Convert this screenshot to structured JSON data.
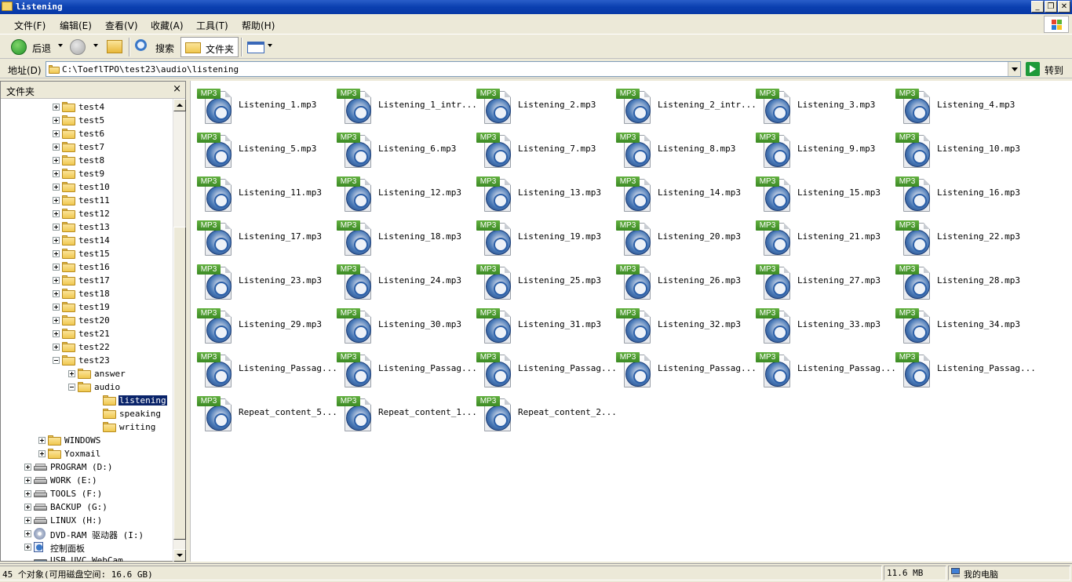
{
  "window": {
    "title": "listening",
    "controls": [
      "minimize",
      "restore",
      "close"
    ]
  },
  "menu": {
    "items": [
      "文件(F)",
      "编辑(E)",
      "查看(V)",
      "收藏(A)",
      "工具(T)",
      "帮助(H)"
    ]
  },
  "toolbar": {
    "back_label": "后退",
    "search_label": "搜索",
    "folders_label": "文件夹"
  },
  "address": {
    "label": "地址(D)",
    "value": "C:\\ToeflTPO\\test23\\audio\\listening",
    "go_label": "转到"
  },
  "folder_pane": {
    "title": "文件夹",
    "close_glyph": "×",
    "tree": [
      {
        "label": "test4",
        "level": 2,
        "expander": "plus",
        "icon": "folder"
      },
      {
        "label": "test5",
        "level": 2,
        "expander": "plus",
        "icon": "folder"
      },
      {
        "label": "test6",
        "level": 2,
        "expander": "plus",
        "icon": "folder"
      },
      {
        "label": "test7",
        "level": 2,
        "expander": "plus",
        "icon": "folder"
      },
      {
        "label": "test8",
        "level": 2,
        "expander": "plus",
        "icon": "folder"
      },
      {
        "label": "test9",
        "level": 2,
        "expander": "plus",
        "icon": "folder"
      },
      {
        "label": "test10",
        "level": 2,
        "expander": "plus",
        "icon": "folder"
      },
      {
        "label": "test11",
        "level": 2,
        "expander": "plus",
        "icon": "folder"
      },
      {
        "label": "test12",
        "level": 2,
        "expander": "plus",
        "icon": "folder"
      },
      {
        "label": "test13",
        "level": 2,
        "expander": "plus",
        "icon": "folder"
      },
      {
        "label": "test14",
        "level": 2,
        "expander": "plus",
        "icon": "folder"
      },
      {
        "label": "test15",
        "level": 2,
        "expander": "plus",
        "icon": "folder"
      },
      {
        "label": "test16",
        "level": 2,
        "expander": "plus",
        "icon": "folder"
      },
      {
        "label": "test17",
        "level": 2,
        "expander": "plus",
        "icon": "folder"
      },
      {
        "label": "test18",
        "level": 2,
        "expander": "plus",
        "icon": "folder"
      },
      {
        "label": "test19",
        "level": 2,
        "expander": "plus",
        "icon": "folder"
      },
      {
        "label": "test20",
        "level": 2,
        "expander": "plus",
        "icon": "folder"
      },
      {
        "label": "test21",
        "level": 2,
        "expander": "plus",
        "icon": "folder"
      },
      {
        "label": "test22",
        "level": 2,
        "expander": "plus",
        "icon": "folder"
      },
      {
        "label": "test23",
        "level": 2,
        "expander": "minus",
        "icon": "folder"
      },
      {
        "label": "answer",
        "level": 3,
        "expander": "plus",
        "icon": "folder"
      },
      {
        "label": "audio",
        "level": 3,
        "expander": "minus",
        "icon": "folder"
      },
      {
        "label": "listening",
        "level": 4,
        "expander": "none",
        "icon": "folder",
        "selected": true
      },
      {
        "label": "speaking",
        "level": 4,
        "expander": "none",
        "icon": "folder"
      },
      {
        "label": "writing",
        "level": 4,
        "expander": "none",
        "icon": "folder"
      },
      {
        "label": "WINDOWS",
        "level": 1,
        "expander": "plus",
        "icon": "folder"
      },
      {
        "label": "Yoxmail",
        "level": 1,
        "expander": "plus",
        "icon": "folder"
      },
      {
        "label": "PROGRAM (D:)",
        "level": 0,
        "expander": "plus",
        "icon": "drive"
      },
      {
        "label": "WORK (E:)",
        "level": 0,
        "expander": "plus",
        "icon": "drive"
      },
      {
        "label": "TOOLS (F:)",
        "level": 0,
        "expander": "plus",
        "icon": "drive"
      },
      {
        "label": "BACKUP (G:)",
        "level": 0,
        "expander": "plus",
        "icon": "drive"
      },
      {
        "label": "LINUX (H:)",
        "level": 0,
        "expander": "plus",
        "icon": "drive"
      },
      {
        "label": "DVD-RAM 驱动器 (I:)",
        "level": 0,
        "expander": "plus",
        "icon": "dvd"
      },
      {
        "label": "控制面板",
        "level": 0,
        "expander": "plus",
        "icon": "control-panel"
      },
      {
        "label": "USB UVC WebCam",
        "level": 0,
        "expander": "none",
        "icon": "webcam"
      }
    ]
  },
  "files": {
    "badge": "MP3",
    "items": [
      "Listening_1.mp3",
      "Listening_1_intr...",
      "Listening_2.mp3",
      "Listening_2_intr...",
      "Listening_3.mp3",
      "Listening_4.mp3",
      "Listening_5.mp3",
      "Listening_6.mp3",
      "Listening_7.mp3",
      "Listening_8.mp3",
      "Listening_9.mp3",
      "Listening_10.mp3",
      "Listening_11.mp3",
      "Listening_12.mp3",
      "Listening_13.mp3",
      "Listening_14.mp3",
      "Listening_15.mp3",
      "Listening_16.mp3",
      "Listening_17.mp3",
      "Listening_18.mp3",
      "Listening_19.mp3",
      "Listening_20.mp3",
      "Listening_21.mp3",
      "Listening_22.mp3",
      "Listening_23.mp3",
      "Listening_24.mp3",
      "Listening_25.mp3",
      "Listening_26.mp3",
      "Listening_27.mp3",
      "Listening_28.mp3",
      "Listening_29.mp3",
      "Listening_30.mp3",
      "Listening_31.mp3",
      "Listening_32.mp3",
      "Listening_33.mp3",
      "Listening_34.mp3",
      "Listening_Passag...",
      "Listening_Passag...",
      "Listening_Passag...",
      "Listening_Passag...",
      "Listening_Passag...",
      "Listening_Passag...",
      "Repeat_content_5...",
      "Repeat_content_1...",
      "Repeat_content_2..."
    ]
  },
  "status": {
    "objects": "45 个对象(可用磁盘空间: 16.6 GB)",
    "size": "11.6 MB",
    "location": "我的电脑"
  },
  "colors": {
    "title_bar": "#0a3fb0",
    "selection": "#0a246a",
    "mp3_badge": "#3c8a24",
    "chrome": "#ece9d8"
  }
}
